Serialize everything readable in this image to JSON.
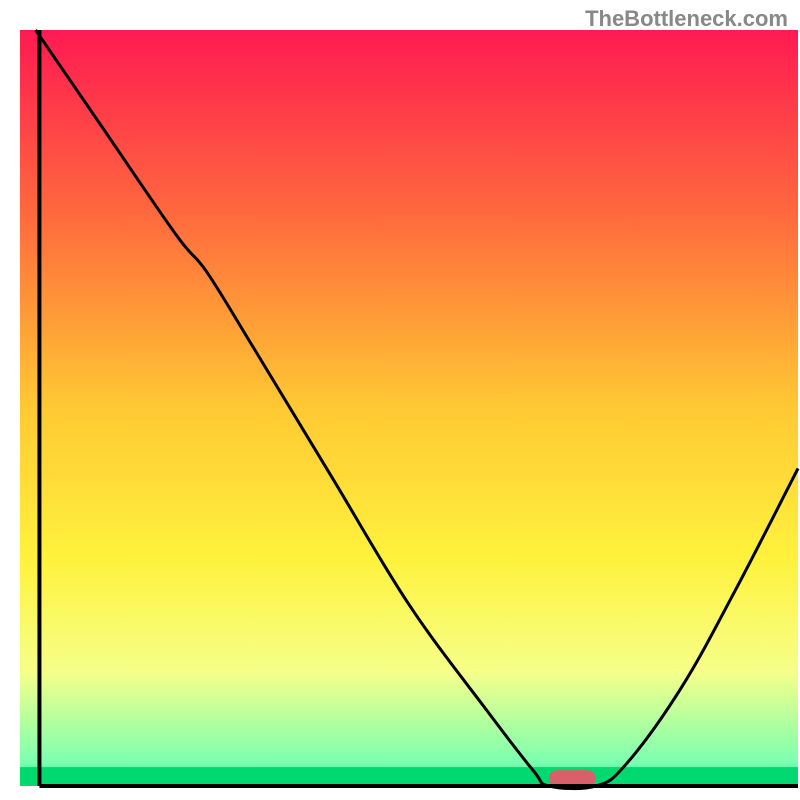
{
  "watermark": "TheBottleneck.com",
  "chart_data": {
    "type": "line",
    "title": "",
    "xlabel": "",
    "ylabel": "",
    "xlim": [
      0,
      100
    ],
    "ylim": [
      0,
      100
    ],
    "background_gradient": {
      "stops": [
        {
          "offset": 0,
          "color": "#ff1a52"
        },
        {
          "offset": 25,
          "color": "#ff6b3d"
        },
        {
          "offset": 50,
          "color": "#ffc933"
        },
        {
          "offset": 70,
          "color": "#fff23d"
        },
        {
          "offset": 85,
          "color": "#f5ff8a"
        },
        {
          "offset": 97,
          "color": "#7affb0"
        },
        {
          "offset": 100,
          "color": "#00d870"
        }
      ]
    },
    "green_band_height": 2.5,
    "curve_points": [
      {
        "x": 2,
        "y": 100
      },
      {
        "x": 10,
        "y": 88
      },
      {
        "x": 20,
        "y": 73
      },
      {
        "x": 24,
        "y": 68
      },
      {
        "x": 30,
        "y": 58
      },
      {
        "x": 40,
        "y": 41
      },
      {
        "x": 50,
        "y": 24
      },
      {
        "x": 60,
        "y": 10
      },
      {
        "x": 66,
        "y": 2
      },
      {
        "x": 68,
        "y": 0
      },
      {
        "x": 74,
        "y": 0
      },
      {
        "x": 78,
        "y": 3
      },
      {
        "x": 85,
        "y": 13
      },
      {
        "x": 92,
        "y": 26
      },
      {
        "x": 100,
        "y": 42
      }
    ],
    "marker": {
      "x": 71,
      "y": 1,
      "color": "#d9606a",
      "width": 6,
      "height": 2.2
    },
    "axes": {
      "left": {
        "x": 2.5,
        "y0": 0,
        "y1": 100
      },
      "bottom": {
        "y": 0,
        "x0": 2.5,
        "x1": 100
      }
    }
  }
}
